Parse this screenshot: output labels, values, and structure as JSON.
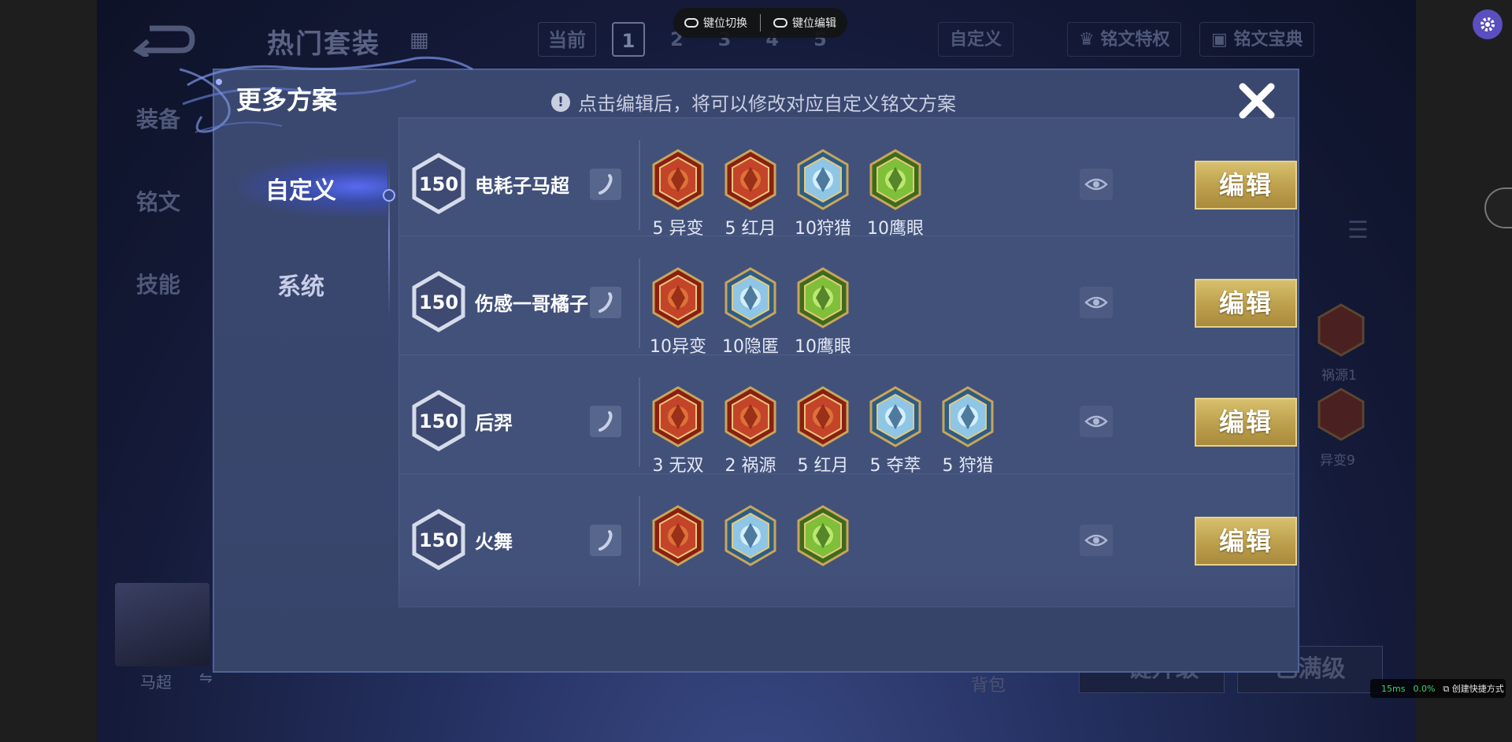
{
  "background": {
    "title": "热门套装",
    "tabs": [
      "当前",
      "1",
      "2",
      "3",
      "4",
      "5"
    ],
    "custom_tab": "自定义",
    "rune_privilege": "铭文特权",
    "rune_codex": "铭文宝典",
    "side_menu": [
      "装备",
      "铭文",
      "技能"
    ],
    "side_runes": [
      "祸源1",
      "异变9"
    ],
    "hero_name": "马超",
    "swap_glyph": "⇋",
    "bag": "背包",
    "btn_upgrade": "一键升级",
    "btn_maxed": "已满级"
  },
  "ctrl_bar": {
    "key_switch": "键位切换",
    "key_edit": "键位编辑"
  },
  "status": {
    "latency": "15ms",
    "loss": "0.0%",
    "shortcut": "创建快捷方式",
    "latency_color": "#3fd46a",
    "loss_color": "#3fd46a"
  },
  "modal": {
    "title": "更多方案",
    "hint": "点击编辑后，将可以修改对应自定义铭文方案",
    "info_glyph": "!",
    "tabs": [
      {
        "label": "自定义",
        "active": true
      },
      {
        "label": "系统",
        "active": false
      }
    ],
    "edit_label": "编辑",
    "plans": [
      {
        "level": "150",
        "name": "电耗子马超",
        "runes": [
          {
            "label": "5 异变",
            "color": "red",
            "icon": "mutation-rune-icon"
          },
          {
            "label": "5 红月",
            "color": "red",
            "icon": "red-moon-rune-icon"
          },
          {
            "label": "10狩猎",
            "color": "blue",
            "icon": "hunt-rune-icon"
          },
          {
            "label": "10鹰眼",
            "color": "green",
            "icon": "hawk-eye-rune-icon"
          }
        ]
      },
      {
        "level": "150",
        "name": "伤感一哥橘子",
        "runes": [
          {
            "label": "10异变",
            "color": "red",
            "icon": "mutation-rune-icon"
          },
          {
            "label": "10隐匿",
            "color": "blue",
            "icon": "stealth-rune-icon"
          },
          {
            "label": "10鹰眼",
            "color": "green",
            "icon": "hawk-eye-rune-icon"
          }
        ]
      },
      {
        "level": "150",
        "name": "后羿",
        "runes": [
          {
            "label": "3 无双",
            "color": "red",
            "icon": "peerless-rune-icon"
          },
          {
            "label": "2 祸源",
            "color": "red",
            "icon": "calamity-rune-icon"
          },
          {
            "label": "5 红月",
            "color": "red",
            "icon": "red-moon-rune-icon"
          },
          {
            "label": "5 夺萃",
            "color": "blue",
            "icon": "plunder-rune-icon"
          },
          {
            "label": "5 狩猎",
            "color": "blue",
            "icon": "hunt-rune-icon"
          }
        ]
      },
      {
        "level": "150",
        "name": "火舞",
        "runes": [
          {
            "label": "",
            "color": "red",
            "icon": "rune-icon"
          },
          {
            "label": "",
            "color": "blue",
            "icon": "rune-icon"
          },
          {
            "label": "",
            "color": "green",
            "icon": "rune-icon"
          }
        ]
      }
    ]
  },
  "colors": {
    "accent_gold": "#d7c06e",
    "modal_bg": "#3a4870",
    "settings_purple": "#5b4ec0"
  }
}
